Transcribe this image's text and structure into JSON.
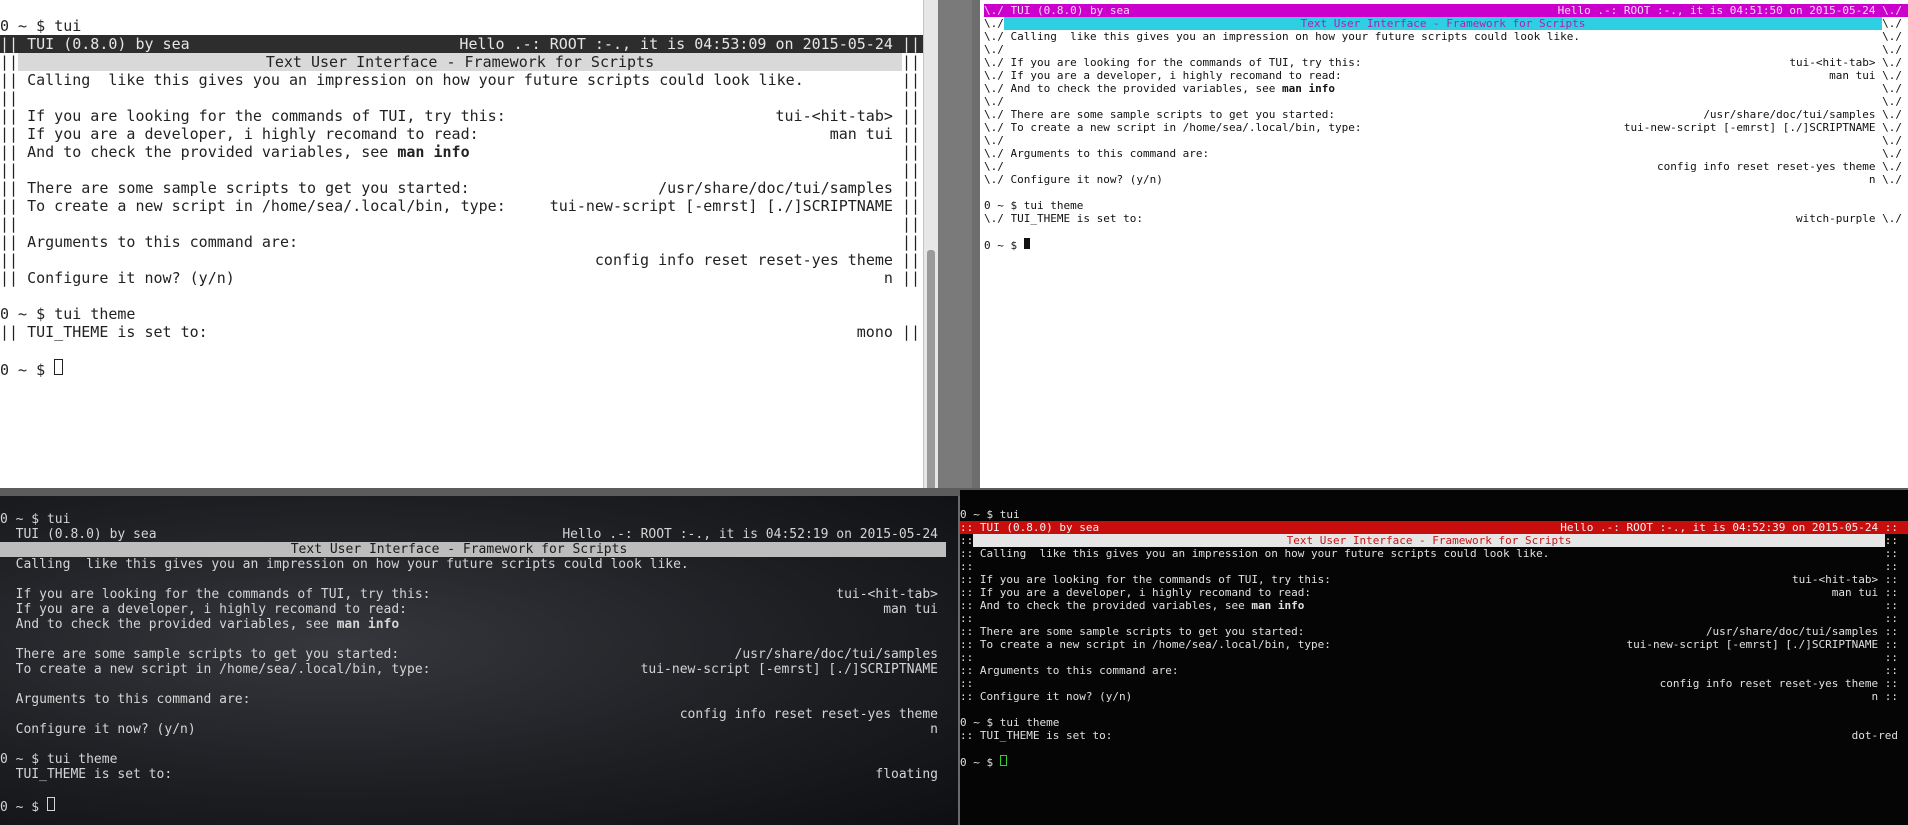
{
  "panes": {
    "mono": {
      "prompt": "0 ~ $ ",
      "command": "tui",
      "border_left": "||",
      "border_right": "||",
      "header_left": "TUI (0.8.0) by sea",
      "header_right": "Hello .-: ROOT :-., it is 04:53:09 on 2015-05-24",
      "subtitle": "Text User Interface - Framework for Scripts",
      "calling": "Calling  like this gives you an impression on how your future scripts could look like.",
      "looking_text": "If you are looking for the commands of TUI, try this:",
      "looking_value": "tui-<hit-tab>",
      "developer_text": "If you are a developer, i highly recomand to read:",
      "developer_value": "man tui",
      "variables_text": "And to check the provided variables, see ",
      "variables_bold": "man info",
      "samples_text": "There are some sample scripts to get you started:",
      "samples_value": "/usr/share/doc/tui/samples",
      "create_text": "To create a new script in /home/sea/.local/bin, type:",
      "create_value": "tui-new-script [-emrst] [./]SCRIPTNAME",
      "args_text": "Arguments to this command are:",
      "args_value": "config info reset reset-yes theme",
      "configure_text": "Configure it now? (y/n)",
      "configure_value": "n",
      "command2": "tui theme",
      "theme_text": "TUI_THEME is set to:",
      "theme_value": "mono"
    },
    "witch_purple": {
      "prompt": "0 ~ $ ",
      "command2": "tui theme",
      "border_left": "\\./",
      "border_right": "\\./",
      "header_left": "TUI (0.8.0) by sea",
      "header_right": "Hello .-: ROOT :-., it is 04:51:50 on 2015-05-24",
      "subtitle": "Text User Interface - Framework for Scripts",
      "calling": "Calling  like this gives you an impression on how your future scripts could look like.",
      "looking_text": "If you are looking for the commands of TUI, try this:",
      "looking_value": "tui-<hit-tab>",
      "developer_text": "If you are a developer, i highly recomand to read:",
      "developer_value": "man tui",
      "variables_text": "And to check the provided variables, see ",
      "variables_bold": "man info",
      "samples_text": "There are some sample scripts to get you started:",
      "samples_value": "/usr/share/doc/tui/samples",
      "create_text": "To create a new script in /home/sea/.local/bin, type:",
      "create_value": "tui-new-script [-emrst] [./]SCRIPTNAME",
      "args_text": "Arguments to this command are:",
      "args_value": "config info reset reset-yes theme",
      "configure_text": "Configure it now? (y/n)",
      "configure_value": "n",
      "theme_text": "TUI_THEME is set to:",
      "theme_value": "witch-purple"
    },
    "floating": {
      "prompt": "0 ~ $ ",
      "command": "tui",
      "header_left": "TUI (0.8.0) by sea",
      "header_right": "Hello .-: ROOT :-., it is 04:52:19 on 2015-05-24",
      "subtitle": "Text User Interface - Framework for Scripts",
      "calling": "Calling  like this gives you an impression on how your future scripts could look like.",
      "looking_text": "If you are looking for the commands of TUI, try this:",
      "looking_value": "tui-<hit-tab>",
      "developer_text": "If you are a developer, i highly recomand to read:",
      "developer_value": "man tui",
      "variables_text": "And to check the provided variables, see ",
      "variables_bold": "man info",
      "samples_text": "There are some sample scripts to get you started:",
      "samples_value": "/usr/share/doc/tui/samples",
      "create_text": "To create a new script in /home/sea/.local/bin, type:",
      "create_value": "tui-new-script [-emrst] [./]SCRIPTNAME",
      "args_text": "Arguments to this command are:",
      "args_value": "config info reset reset-yes theme",
      "configure_text": "Configure it now? (y/n)",
      "configure_value": "n",
      "command2": "tui theme",
      "theme_text": "TUI_THEME is set to:",
      "theme_value": "floating"
    },
    "dot_red": {
      "prompt": "0 ~ $ ",
      "command": "tui",
      "border_left": "::",
      "border_right": "::",
      "header_left": "TUI (0.8.0) by sea",
      "header_right": "Hello .-: ROOT :-., it is 04:52:39 on 2015-05-24",
      "subtitle": "Text User Interface - Framework for Scripts",
      "calling": "Calling  like this gives you an impression on how your future scripts could look like.",
      "looking_text": "If you are looking for the commands of TUI, try this:",
      "looking_value": "tui-<hit-tab>",
      "developer_text": "If you are a developer, i highly recomand to read:",
      "developer_value": "man tui",
      "variables_text": "And to check the provided variables, see ",
      "variables_bold": "man info",
      "samples_text": "There are some sample scripts to get you started:",
      "samples_value": "/usr/share/doc/tui/samples",
      "create_text": "To create a new script in /home/sea/.local/bin, type:",
      "create_value": "tui-new-script [-emrst] [./]SCRIPTNAME",
      "args_text": "Arguments to this command are:",
      "args_value": "config info reset reset-yes theme",
      "configure_text": "Configure it now? (y/n)",
      "configure_value": "n",
      "command2": "tui theme",
      "theme_text": "TUI_THEME is set to:",
      "theme_value": "dot-red"
    }
  },
  "colors": {
    "mono_header": "#2d2d2d",
    "witch_header": "#cc00cc",
    "witch_subtitle": "#2ecfe3",
    "dot_red_header": "#c80d0d",
    "cursor_green": "#2fd12f"
  }
}
